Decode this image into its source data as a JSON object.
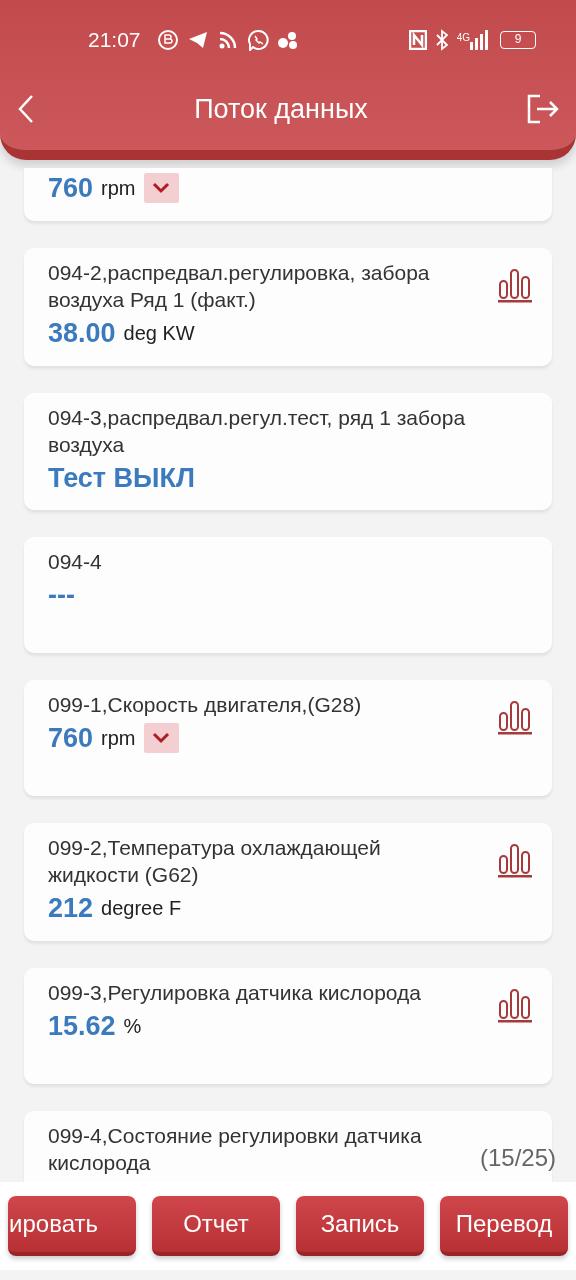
{
  "status_bar": {
    "time": "21:07",
    "network": "4G",
    "battery": "9"
  },
  "header": {
    "title": "Поток данных"
  },
  "items": [
    {
      "value": "760",
      "unit": "rpm",
      "chart": false,
      "dropdown": true
    },
    {
      "title": "094-2,распредвал.регулировка, забора воздуха Ряд 1 (факт.)",
      "value": "38.00",
      "unit": "deg KW",
      "chart": true,
      "dropdown": false
    },
    {
      "title": "094-3,распредвал.регул.тест, ряд 1 забора воздуха",
      "value": "Тест ВЫКЛ",
      "chart": false,
      "dropdown": false
    },
    {
      "title": "094-4",
      "value": "---",
      "chart": false,
      "dropdown": false
    },
    {
      "title": "099-1,Скорость двигателя,(G28)",
      "value": "760",
      "unit": "rpm",
      "chart": true,
      "dropdown": true
    },
    {
      "title": "099-2,Температура охлаждающей жидкости (G62)",
      "value": "212",
      "unit": "degree F",
      "chart": true,
      "dropdown": false
    },
    {
      "title": "099-3,Регулировка датчика кислорода",
      "value": "15.62",
      "unit": "%",
      "chart": true,
      "dropdown": false
    },
    {
      "title": "099-4,Состояние регулировки датчика кислорода",
      "chart": false
    }
  ],
  "page_counter": "(15/25)",
  "buttons": [
    "ировать",
    "Отчет",
    "Запись",
    "Перевод"
  ]
}
